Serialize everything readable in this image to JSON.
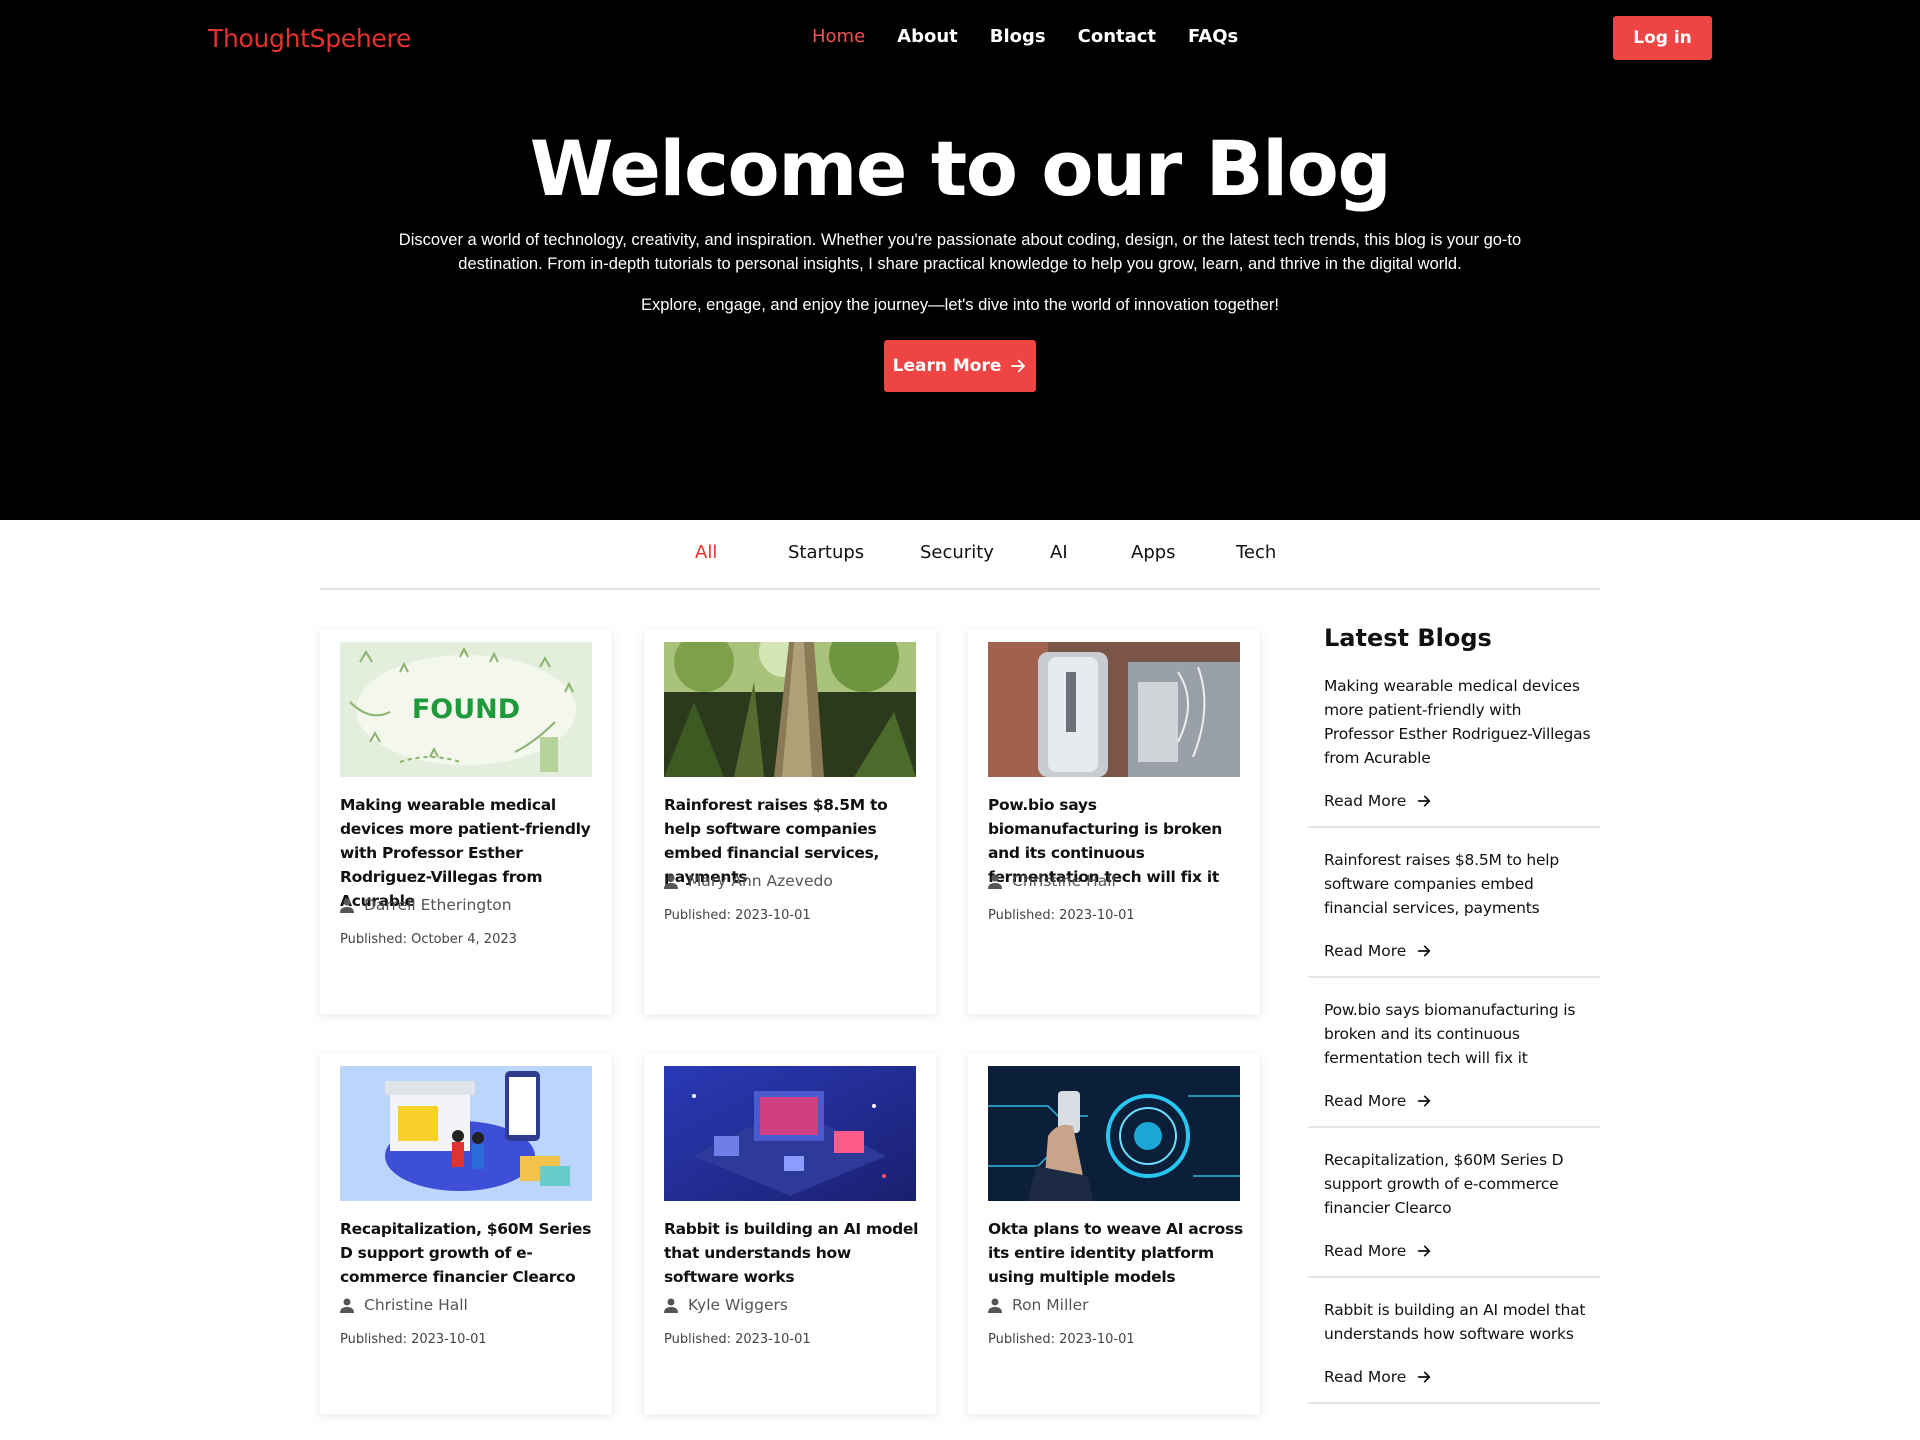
{
  "header": {
    "brand": "ThoughtSpehere",
    "nav": [
      "Home",
      "About",
      "Blogs",
      "Contact",
      "FAQs"
    ],
    "login_label": "Log in"
  },
  "hero": {
    "title": "Welcome to our Blog",
    "description": "Discover a world of technology, creativity, and inspiration. Whether you're passionate about coding, design, or the latest tech trends, this blog is your go-to destination. From in-depth tutorials to personal insights, I share practical knowledge to help you grow, learn, and thrive in the digital world.",
    "subtitle": "Explore, engage, and enjoy the journey—let's dive into the world of innovation together!",
    "button_label": "Learn More"
  },
  "tabs": [
    "All",
    "Startups",
    "Security",
    "AI",
    "Apps",
    "Tech"
  ],
  "cards": [
    {
      "title": "Making wearable medical devices more patient-friendly with Professor Esther Rodriguez-Villegas from Acurable",
      "author": "Darrell Etherington",
      "published": "Published: October 4, 2023",
      "image": "found-illustration",
      "image_text": "FOUND"
    },
    {
      "title": "Rainforest raises $8.5M to help software companies embed financial services, payments",
      "author": "Mary Ann Azevedo",
      "published": "Published: 2023-10-01",
      "image": "rainforest-photo"
    },
    {
      "title": "Pow.bio says biomanufacturing is broken and its continuous fermentation tech will fix it",
      "author": "Christine Hall",
      "published": "Published: 2023-10-01",
      "image": "bioreactor-photo"
    },
    {
      "title": "Recapitalization, $60M Series D support growth of e-commerce financier Clearco",
      "author": "Christine Hall",
      "published": "Published: 2023-10-01",
      "image": "ecommerce-illustration"
    },
    {
      "title": "Rabbit is building an AI model that understands how software works",
      "author": "Kyle Wiggers",
      "published": "Published: 2023-10-01",
      "image": "isometric-tech-illustration"
    },
    {
      "title": "Okta plans to weave AI across its entire identity platform using multiple models",
      "author": "Ron Miller",
      "published": "Published: 2023-10-01",
      "image": "hand-phone-digital-photo"
    }
  ],
  "sidebar": {
    "title": "Latest Blogs",
    "read_more_label": "Read More",
    "items": [
      "Making wearable medical devices more patient-friendly with Professor Esther Rodriguez-Villegas from Acurable",
      "Rainforest raises $8.5M to help software companies embed financial services, payments",
      "Pow.bio says biomanufacturing is broken and its continuous fermentation tech will fix it",
      "Recapitalization, $60M Series D support growth of e-commerce financier Clearco",
      "Rabbit is building an AI model that understands how software works"
    ]
  },
  "colors": {
    "accent": "#ef4444",
    "brand": "#e5322f",
    "hero_bg": "#000000"
  }
}
